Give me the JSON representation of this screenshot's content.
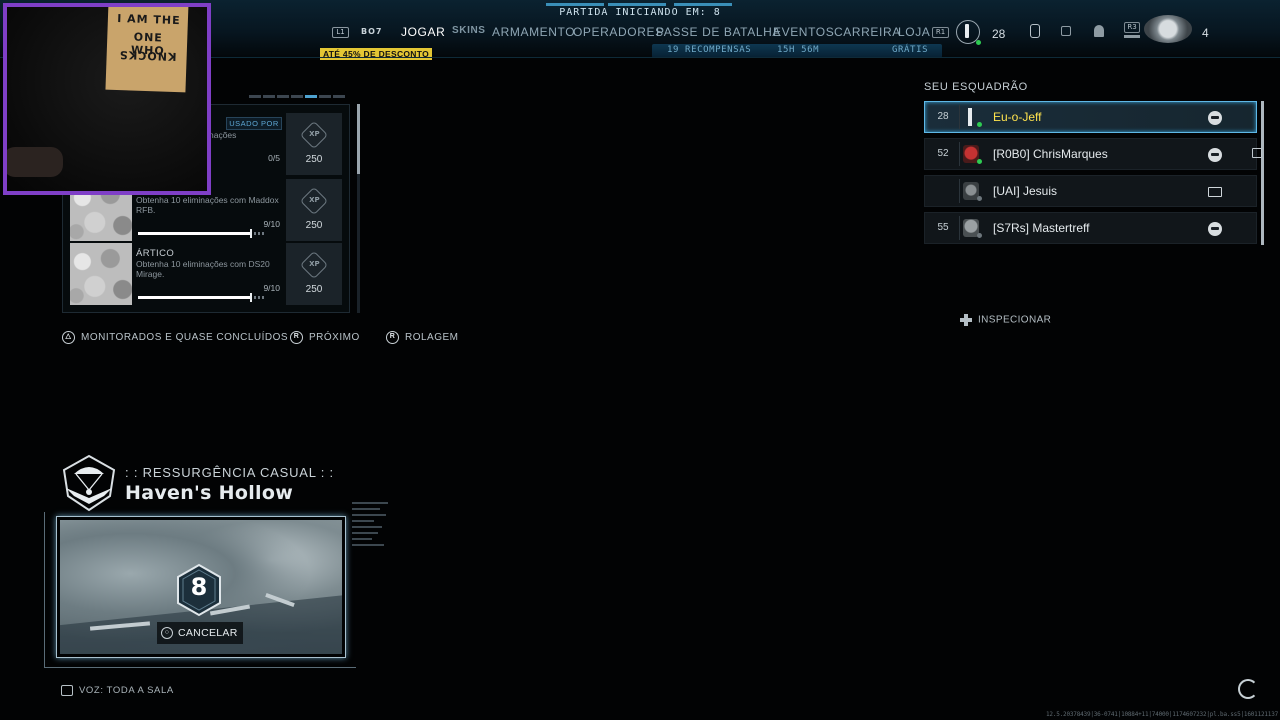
{
  "header": {
    "match_status": "PARTIDA INICIANDO EM: 8",
    "controller_left": "L1",
    "game_badge": "BO7",
    "controller_right": "R1",
    "nav": [
      {
        "label": "JOGAR",
        "active": true
      },
      {
        "label": "SKINS",
        "active": false
      },
      {
        "label": "ARMAMENTO",
        "active": false
      },
      {
        "label": "OPERADORES",
        "active": false
      },
      {
        "label": "PASSE DE BATALHA",
        "active": false
      },
      {
        "label": "EVENTOS",
        "active": false
      },
      {
        "label": "CARREIRA",
        "active": false
      },
      {
        "label": "LOJA",
        "active": false
      }
    ],
    "discount": "ATÉ 45% DE DESCONTO",
    "battlepass_rewards": "19 RECOMPENSAS",
    "event_timer": "15H 56M",
    "store_sub": "GRÁTIS",
    "level": "28",
    "r3_label": "R3",
    "party_count": "4",
    "accent": "#4ea2d0"
  },
  "challenges": {
    "used_by": "USADO POR",
    "rows": [
      {
        "title": "",
        "desc": "nações",
        "progress": "0/5",
        "xp": "250",
        "fill": 0.0,
        "icon": "xp-icon"
      },
      {
        "title": "",
        "desc": "Obtenha 10 eliminações com Maddox RFB.",
        "progress": "9/10",
        "xp": "250",
        "fill": 0.9,
        "icon": "xp-icon"
      },
      {
        "title": "ÁRTICO",
        "desc": "Obtenha 10 eliminações com DS20 Mirage.",
        "progress": "9/10",
        "xp": "250",
        "fill": 0.9,
        "icon": "xp-icon"
      }
    ]
  },
  "prompts": {
    "tracked": "MONITORADOS E QUASE CONCLUÍDOS",
    "tracked_glyph": "△",
    "next": "PRÓXIMO",
    "next_glyph": "R",
    "scroll": "ROLAGEM",
    "scroll_glyph": "R",
    "inspect": "INSPECIONAR"
  },
  "squad": {
    "title": "SEU ESQUADRÃO",
    "members": [
      {
        "level": "28",
        "name": "Eu-o-Jeff",
        "platform": "playstation",
        "status": "online",
        "me": true
      },
      {
        "level": "52",
        "name": "[R0B0] ChrisMarques",
        "platform": "playstation",
        "status": "online",
        "me": false
      },
      {
        "level": "",
        "name": "[UAI] Jesuis",
        "platform": "pc",
        "status": "idle",
        "me": false
      },
      {
        "level": "55",
        "name": "[S7Rs] Mastertreff",
        "platform": "playstation",
        "status": "idle",
        "me": false
      }
    ]
  },
  "playlist": {
    "mode": ": : RESSURGÊNCIA CASUAL : :",
    "map": "Haven's Hollow",
    "countdown": "8",
    "cancel": "CANCELAR"
  },
  "footer": {
    "voice": "VOZ: TODA A SALA",
    "build": "12.5.20378439|36-0741|10884+11|74000|1174607232|pl.ba.ss5|1601121137"
  },
  "webcam": {
    "shirt_lines": [
      "I AM THE",
      "ONE WHO",
      "KNOCKS"
    ]
  }
}
